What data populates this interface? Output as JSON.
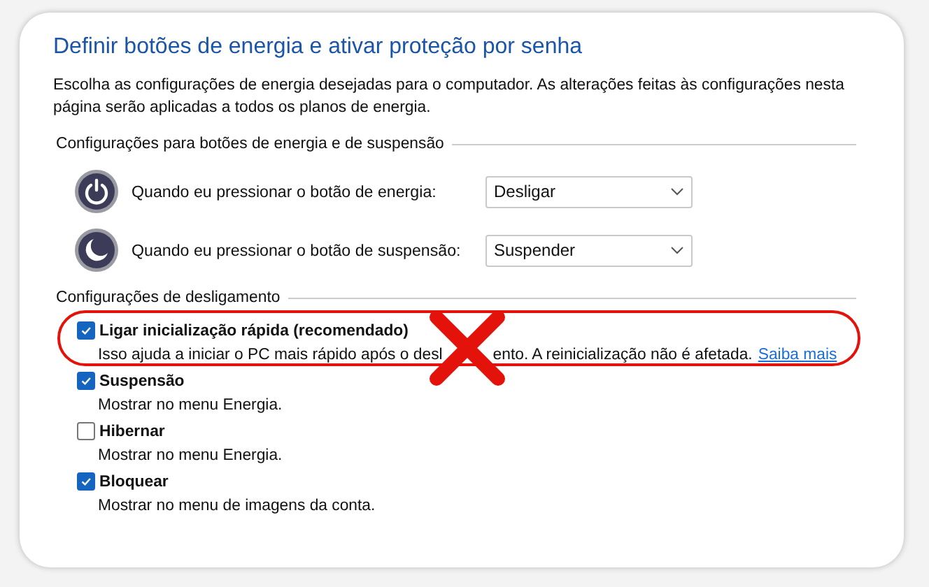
{
  "title": "Definir botões de energia e ativar proteção por senha",
  "intro": "Escolha as configurações de energia desejadas para o computador. As alterações feitas às configurações nesta página serão aplicadas a todos os planos de energia.",
  "buttons_section": {
    "heading": "Configurações para botões de energia e de suspensão",
    "rows": [
      {
        "kind": "power",
        "label": "Quando eu pressionar o botão de energia:",
        "value": "Desligar"
      },
      {
        "kind": "sleep",
        "label": "Quando eu pressionar o botão de suspensão:",
        "value": "Suspender"
      }
    ]
  },
  "shutdown_section": {
    "heading": "Configurações de desligamento",
    "items": [
      {
        "label": "Ligar inicialização rápida (recomendado)",
        "checked": true,
        "annotated": true,
        "description_before": "Isso ajuda a iniciar o PC mais rápido após o desl",
        "description_after": "ento. A reinicialização não é afetada.",
        "link": "Saiba mais"
      },
      {
        "label": "Suspensão",
        "checked": true,
        "annotated": false,
        "description_before": "Mostrar no menu Energia."
      },
      {
        "label": "Hibernar",
        "checked": false,
        "annotated": false,
        "description_before": "Mostrar no menu Energia."
      },
      {
        "label": "Bloquear",
        "checked": true,
        "annotated": false,
        "description_before": "Mostrar no menu de imagens da conta."
      }
    ]
  }
}
